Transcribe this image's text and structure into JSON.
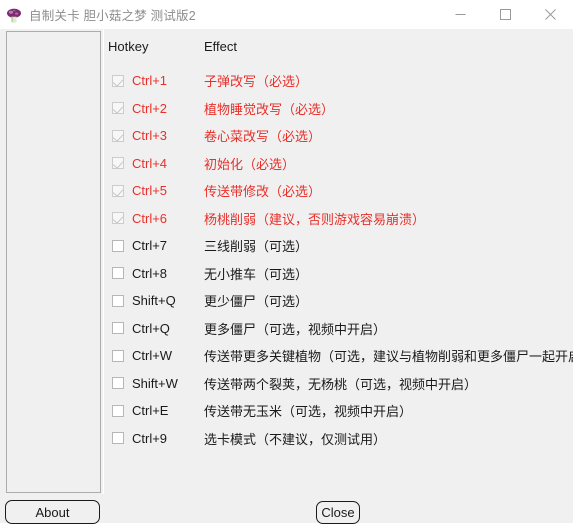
{
  "window": {
    "title": "自制关卡 胆小菇之梦 测试版2",
    "icon": "mushroom-icon",
    "controls": {
      "minimize_label": "—",
      "maximize_label": "□",
      "close_label": "✕"
    }
  },
  "table": {
    "headers": {
      "hotkey": "Hotkey",
      "effect": "Effect"
    },
    "rows": [
      {
        "key": "Ctrl+1",
        "effect": "子弹改写（必选）",
        "checked": true,
        "required": true
      },
      {
        "key": "Ctrl+2",
        "effect": "植物睡觉改写（必选）",
        "checked": true,
        "required": true
      },
      {
        "key": "Ctrl+3",
        "effect": "卷心菜改写（必选）",
        "checked": true,
        "required": true
      },
      {
        "key": "Ctrl+4",
        "effect": "初始化（必选）",
        "checked": true,
        "required": true
      },
      {
        "key": "Ctrl+5",
        "effect": "传送带修改（必选）",
        "checked": true,
        "required": true
      },
      {
        "key": "Ctrl+6",
        "effect": "杨桃削弱（建议，否则游戏容易崩溃）",
        "checked": true,
        "required": true
      },
      {
        "key": "Ctrl+7",
        "effect": "三线削弱（可选）",
        "checked": false,
        "required": false
      },
      {
        "key": "Ctrl+8",
        "effect": "无小推车（可选）",
        "checked": false,
        "required": false
      },
      {
        "key": "Shift+Q",
        "effect": "更少僵尸（可选）",
        "checked": false,
        "required": false
      },
      {
        "key": "Ctrl+Q",
        "effect": "更多僵尸（可选，视频中开启）",
        "checked": false,
        "required": false
      },
      {
        "key": "Ctrl+W",
        "effect": "传送带更多关键植物（可选，建议与植物削弱和更多僵尸一起开启）",
        "checked": false,
        "required": false
      },
      {
        "key": "Shift+W",
        "effect": "传送带两个裂荚，无杨桃（可选，视频中开启）",
        "checked": false,
        "required": false
      },
      {
        "key": "Ctrl+E",
        "effect": "传送带无玉米（可选，视频中开启）",
        "checked": false,
        "required": false
      },
      {
        "key": "Ctrl+9",
        "effect": "选卡模式（不建议，仅测试用）",
        "checked": false,
        "required": false
      }
    ]
  },
  "footer": {
    "about_label": "About",
    "close_label": "Close"
  },
  "colors": {
    "required_text": "#e8302a",
    "optional_text": "#1a1a1a",
    "title_text": "#8d8d8d",
    "client_background": "#f0f0f0",
    "background_window_accent": "#1e94cf"
  }
}
